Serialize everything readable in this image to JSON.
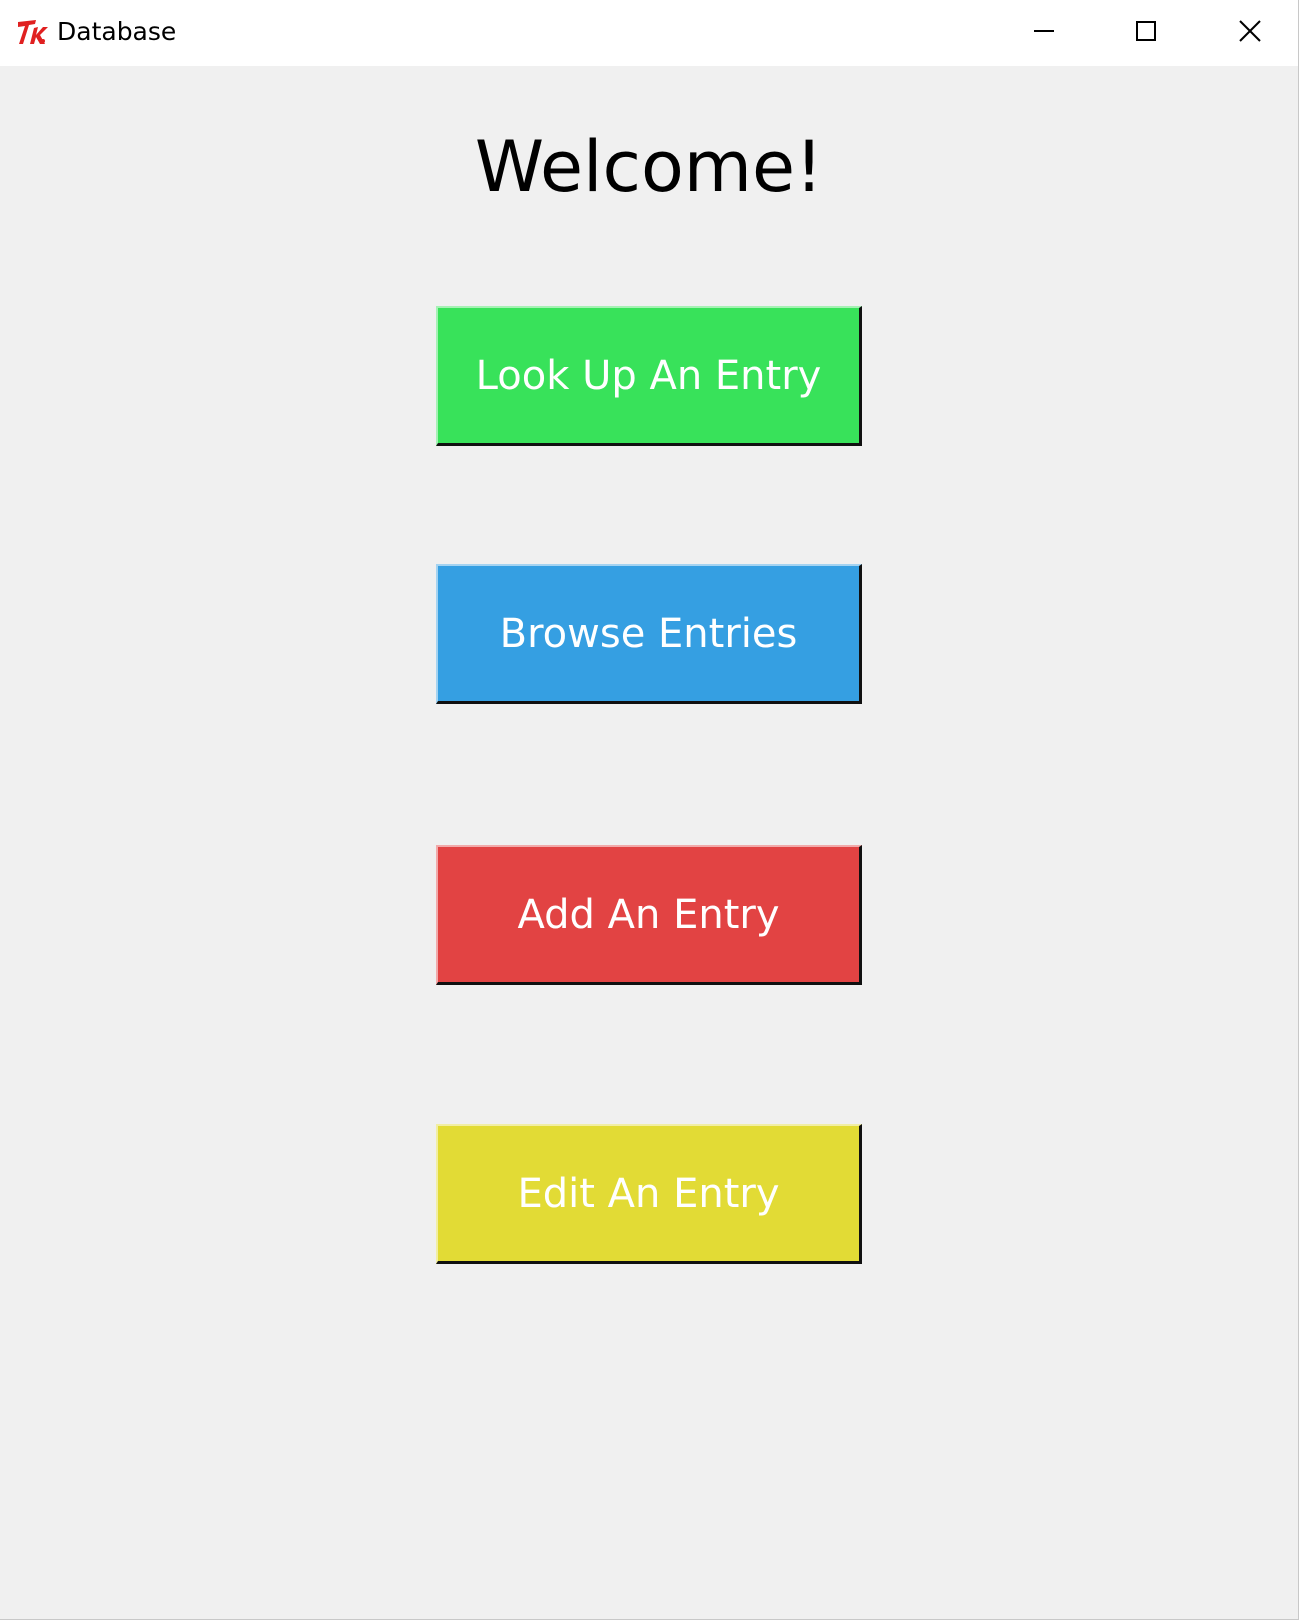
{
  "window": {
    "title": "Database",
    "app_icon": "tk-feather-icon",
    "controls": {
      "minimize_icon": "minimize-icon",
      "maximize_icon": "maximize-icon",
      "close_icon": "close-icon"
    }
  },
  "main": {
    "heading": "Welcome!",
    "buttons": [
      {
        "label": "Look Up An Entry",
        "color": "#38e25a"
      },
      {
        "label": "Browse Entries",
        "color": "#359fe2"
      },
      {
        "label": "Add An Entry",
        "color": "#e24343"
      },
      {
        "label": "Edit An Entry",
        "color": "#e2db35"
      }
    ]
  },
  "colors": {
    "window_background": "#f0f0f0",
    "titlebar_background": "#ffffff",
    "icon_red": "#e02020"
  }
}
